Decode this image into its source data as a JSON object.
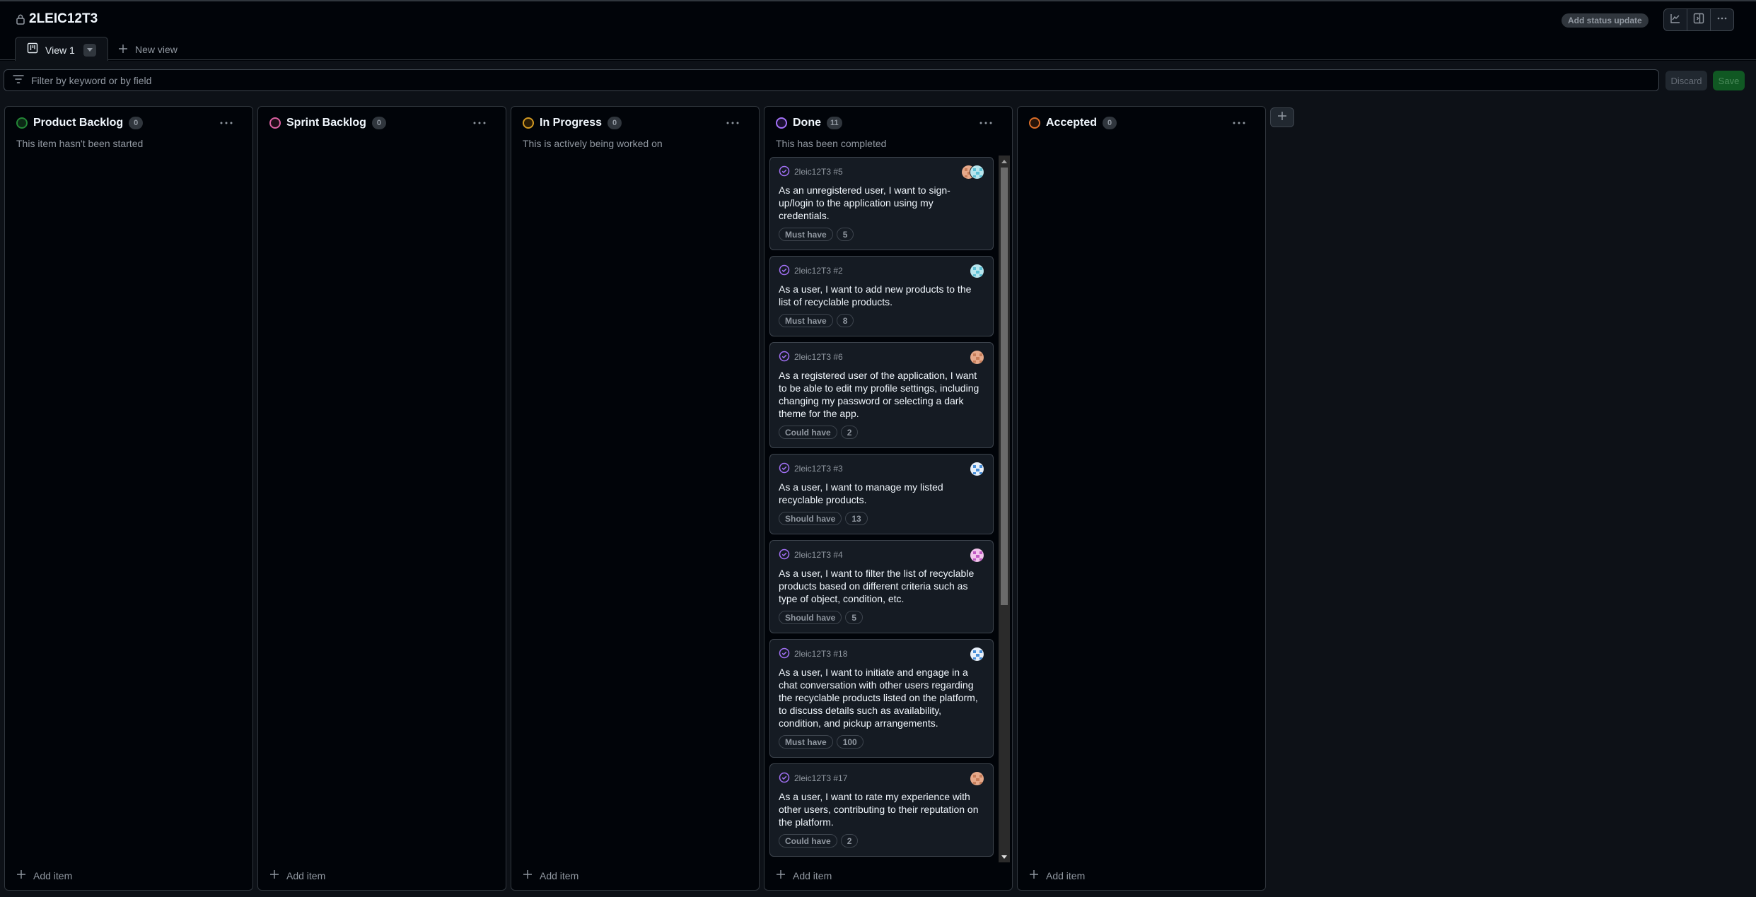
{
  "header": {
    "title": "2LEIC12T3",
    "lock_icon": "lock-icon",
    "status_update_label": "Add status update",
    "toolbar_icons": [
      "insights-icon",
      "sidebar-icon",
      "kebab-icon"
    ]
  },
  "tabs": {
    "active": {
      "label": "View 1",
      "icon": "board-icon"
    },
    "new_view_label": "New view"
  },
  "filter": {
    "placeholder": "Filter by keyword or by field",
    "value": "",
    "discard_label": "Discard",
    "save_label": "Save"
  },
  "colors": {
    "green": "#238636",
    "pink": "#db61a2",
    "yellow": "#d29922",
    "purple": "#a371f7",
    "orange": "#db6d28"
  },
  "columns": [
    {
      "name": "Product Backlog",
      "count": "0",
      "description": "This item hasn't been started",
      "add_label": "Add item"
    },
    {
      "name": "Sprint Backlog",
      "count": "0",
      "description": "",
      "add_label": "Add item"
    },
    {
      "name": "In Progress",
      "count": "0",
      "description": "This is actively being worked on",
      "add_label": "Add item"
    },
    {
      "name": "Done",
      "count": "11",
      "description": "This has been completed",
      "add_label": "Add item",
      "cards": [
        {
          "meta": "2leic12T3 #5",
          "title": "As an unregistered user, I want to sign-up/login to the application using my credentials.",
          "priority": "Must have",
          "estimate": "5",
          "avatars": [
            "orange",
            "teal"
          ]
        },
        {
          "meta": "2leic12T3 #2",
          "title": "As a user, I want to add new products to the list of recyclable products.",
          "priority": "Must have",
          "estimate": "8",
          "avatars": [
            "teal"
          ]
        },
        {
          "meta": "2leic12T3 #6",
          "title": "As a registered user of the application, I want to be able to edit my profile settings, including changing my password or selecting a dark theme for the app.",
          "priority": "Could have",
          "estimate": "2",
          "avatars": [
            "orange"
          ]
        },
        {
          "meta": "2leic12T3 #3",
          "title": "As a user, I want to manage my listed recyclable products.",
          "priority": "Should have",
          "estimate": "13",
          "avatars": [
            "blue"
          ]
        },
        {
          "meta": "2leic12T3 #4",
          "title": "As a user, I want to filter the list of recyclable products based on different criteria such as type of object, condition, etc.",
          "priority": "Should have",
          "estimate": "5",
          "avatars": [
            "magenta"
          ]
        },
        {
          "meta": "2leic12T3 #18",
          "title": "As a user, I want to initiate and engage in a chat conversation with other users regarding the recyclable products listed on the platform, to discuss details such as availability, condition, and pickup arrangements.",
          "priority": "Must have",
          "estimate": "100",
          "avatars": [
            "blue"
          ]
        },
        {
          "meta": "2leic12T3 #17",
          "title": "As a user, I want to rate my experience with other users, contributing to their reputation on the platform.",
          "priority": "Could have",
          "estimate": "2",
          "avatars": [
            "orange"
          ]
        }
      ]
    },
    {
      "name": "Accepted",
      "count": "0",
      "description": "",
      "add_label": "Add item"
    }
  ]
}
